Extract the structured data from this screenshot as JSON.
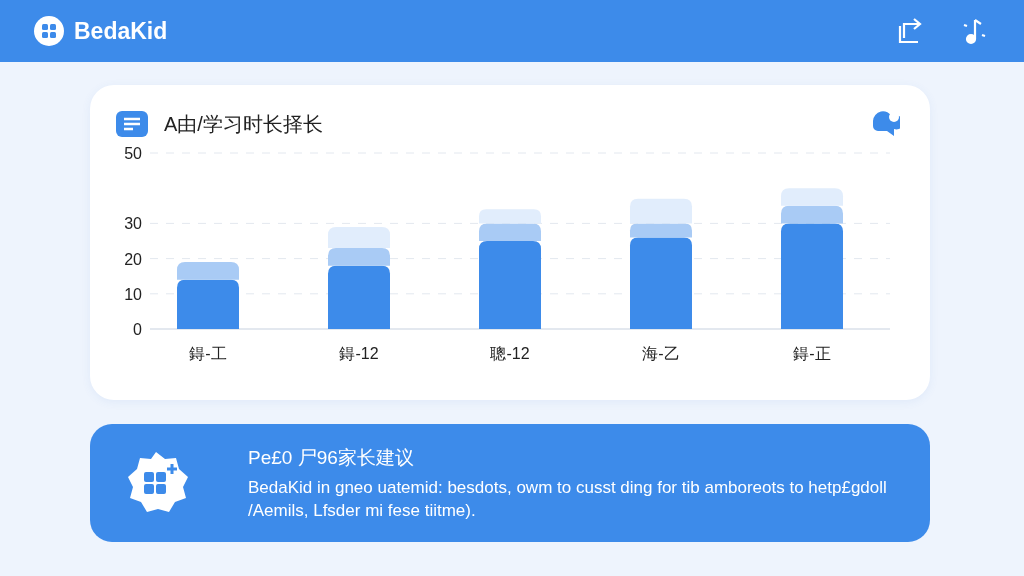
{
  "header": {
    "app_name": "BedaKid"
  },
  "chart_card": {
    "title": "A由/学习时长择长",
    "chart_data": {
      "type": "bar",
      "stacked": true,
      "grid": true,
      "categories": [
        "鍀-工",
        "鍀-12",
        "聰-12",
        "海-乙",
        "鍀-正"
      ],
      "series": [
        {
          "color": "#3d8bea",
          "values": [
            14,
            18,
            25,
            26,
            30
          ]
        },
        {
          "color": "#a9cbf5",
          "values": [
            5,
            5,
            5,
            4,
            5
          ]
        },
        {
          "color": "#e1edfc",
          "values": [
            null,
            6,
            4,
            7,
            5
          ]
        }
      ],
      "ylim": [
        0,
        50
      ],
      "yticks": [
        0,
        10,
        20,
        30,
        50
      ]
    }
  },
  "tip_card": {
    "title": "Pe£0 尸96家长建议",
    "body": "BedaKid in gneo uatemid: besdots, owm to cusst ding for tib amboreots to hetp£gdoll /Aemils, Lfsder mi fese tiitme)."
  }
}
